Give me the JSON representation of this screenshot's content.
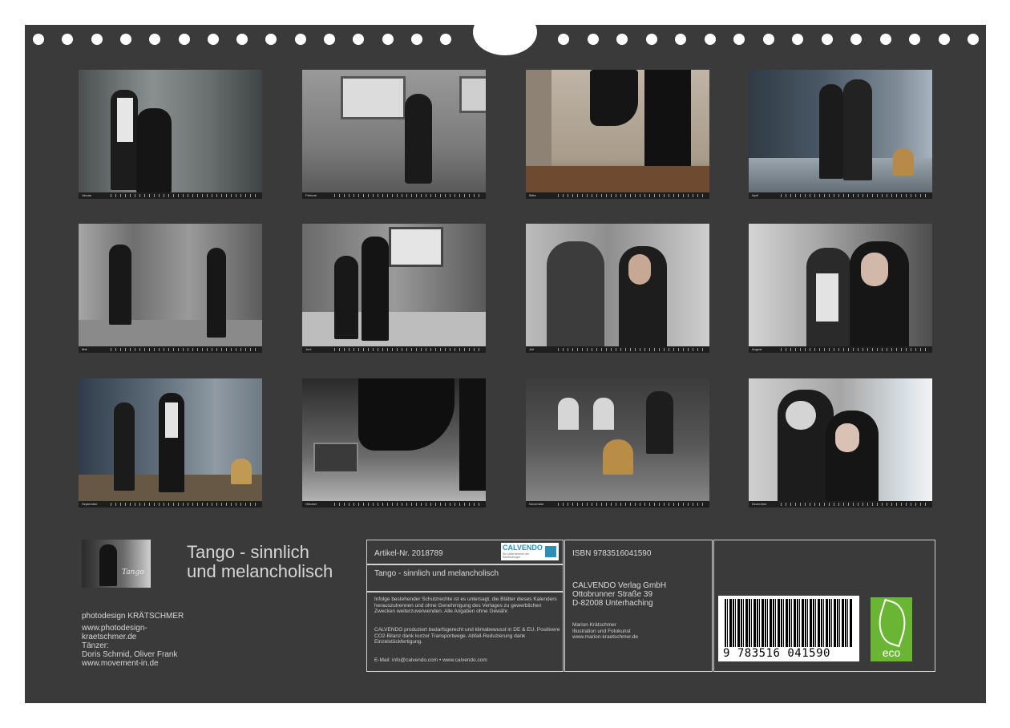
{
  "months": [
    "Januar",
    "Februar",
    "März",
    "April",
    "Mai",
    "Juni",
    "Juli",
    "August",
    "September",
    "Oktober",
    "November",
    "Dezember"
  ],
  "cover_thumb_text": "Tango",
  "title_line1": "Tango - sinnlich",
  "title_line2": "und melancholisch",
  "credits": {
    "studio": "photodesign KRÄTSCHMER",
    "url": "www.photodesign-kraetschmer.de",
    "dancers_label": "Tänzer:",
    "dancers": "Doris Schmid, Oliver Frank",
    "dancers_url": "www.movement-in.de"
  },
  "info": {
    "article": "Artikel-Nr. 2018789",
    "publisher_logo": "CALVENDO",
    "publisher_logo_sub": "Ein Unternehmen der Ravensburger",
    "product_title": "Tango - sinnlich und melancholisch",
    "legal": "Infolge bestehender Schutzrechte ist es untersagt, die Blätter dieses Kalenders herauszutrennen und ohne Genehmigung des Verlages zu gewerblichen Zwecken weiterzuverwenden. Alle Angaben ohne Gewähr.",
    "eco_text": "CALVENDO produziert bedarfsgerecht und klimabewusst in DE & EU. Positivere CO2-Bilanz dank kurzer Transportwege. Abfall-Reduzierung dank Einzelstückfertigung.",
    "contact": "E-Mail: info@calvendo.com • www.calvendo.com",
    "isbn": "ISBN 9783516041590",
    "publisher_name": "CALVENDO Verlag GmbH",
    "publisher_street": "Ottobrunner Straße 39",
    "publisher_city": "D-82008 Unterhaching",
    "author_name": "Marion Krätschmer",
    "author_role": "Illustration und Fotokunst",
    "author_url": "www.marion-kraetschmer.de",
    "barcode_text": "9 783516 041590",
    "eco_label": "eco"
  },
  "colors": {
    "sheet": "#3a3a3a",
    "eco_green": "#6bb535",
    "rule": "#d0d0d0"
  }
}
